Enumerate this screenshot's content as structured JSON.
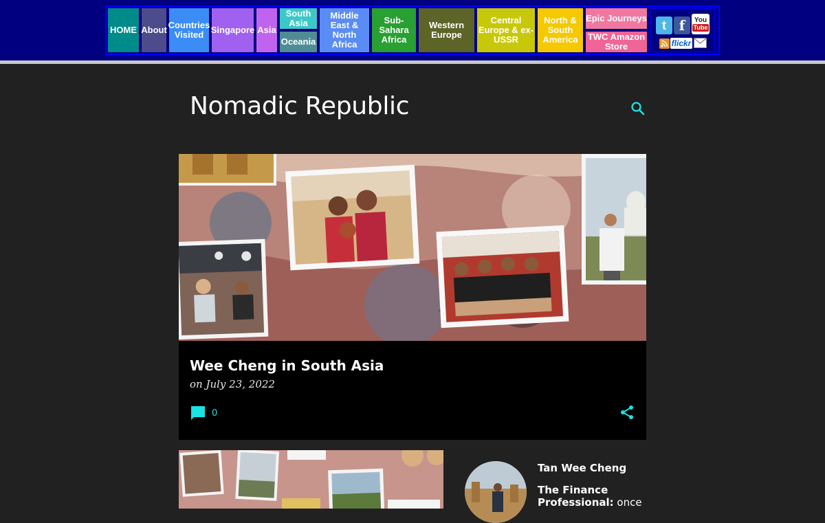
{
  "nav": {
    "items": [
      {
        "label": "HOME",
        "color": "#008b8b"
      },
      {
        "label": "About",
        "color": "#4c4c8c"
      },
      {
        "label": "Countries Visited",
        "color": "#3b8cf5"
      },
      {
        "label": "Singapore",
        "color": "#a060f0"
      },
      {
        "label": "Asia",
        "color": "#c064f0"
      },
      {
        "label": "South Asia",
        "color": "#3cc8c8"
      },
      {
        "label": "Oceania",
        "color": "#4f8c96"
      },
      {
        "label": "Middle East & North Africa",
        "color": "#5a8cf5"
      },
      {
        "label": "Sub-Sahara Africa",
        "color": "#28a032"
      },
      {
        "label": "Western Europe",
        "color": "#5c6428"
      },
      {
        "label": "Central Europe & ex-USSR",
        "color": "#c8c80a"
      },
      {
        "label": "North & South America",
        "color": "#f5c800"
      },
      {
        "label": "Epic Journeys",
        "color": "#f078a0"
      },
      {
        "label": "TWC Amazon Store",
        "color": "#f06496"
      }
    ],
    "social": {
      "twitter": "t",
      "facebook": "f",
      "youtube_top": "You",
      "youtube_bottom": "Tube",
      "flickr": "flickr"
    }
  },
  "blog": {
    "title": "Nomadic Republic"
  },
  "featured_post": {
    "title": "Wee Cheng in South Asia",
    "date": "on July 23, 2022",
    "comment_count": "0"
  },
  "profile": {
    "name": "Tan Wee Cheng",
    "bio_bold": "The Finance Professional:",
    "bio_rest": " once"
  },
  "colors": {
    "accent": "#19e3e3",
    "nav_bg": "#000080",
    "page_bg": "#212121"
  },
  "icons": {
    "search": "search-icon",
    "comment": "comment-icon",
    "share": "share-icon",
    "rss": "rss-icon",
    "mail": "mail-icon"
  }
}
